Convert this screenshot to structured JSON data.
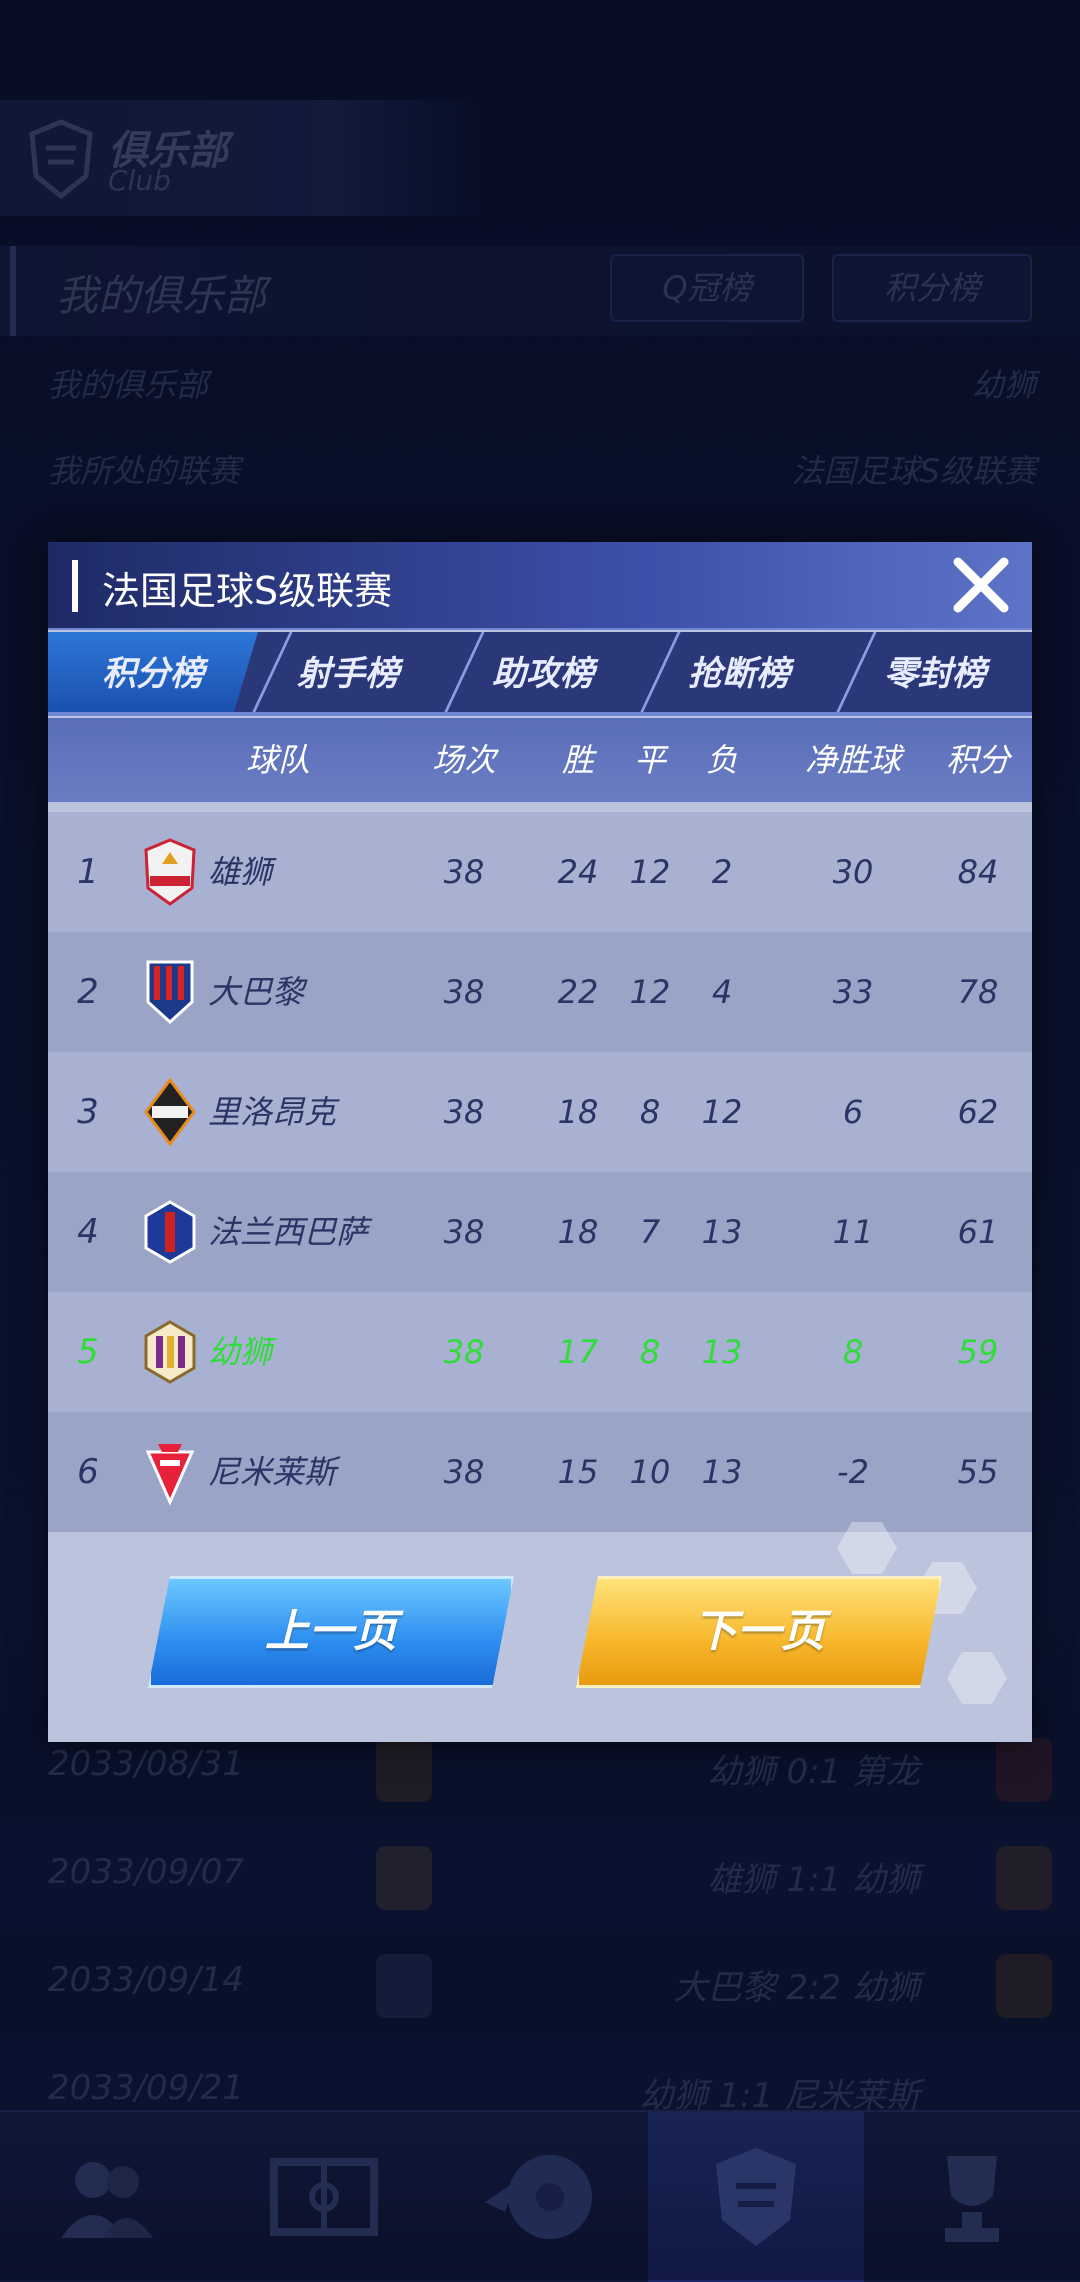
{
  "background": {
    "club_title": "俱乐部",
    "club_subtitle": "Club",
    "section_title": "我的俱乐部",
    "pills": [
      "Q冠榜",
      "积分榜"
    ],
    "info_rows": [
      {
        "label": "我的俱乐部",
        "value": "幼狮"
      },
      {
        "label": "我所处的联赛",
        "value": "法国足球S级联赛"
      }
    ],
    "fixtures": [
      {
        "date": "2033/08/31",
        "match": "幼狮 0:1 第龙"
      },
      {
        "date": "2033/09/07",
        "match": "雄狮 1:1 幼狮"
      },
      {
        "date": "2033/09/14",
        "match": "大巴黎 2:2 幼狮"
      },
      {
        "date": "2033/09/21",
        "match": "幼狮 1:1 尼米莱斯"
      }
    ]
  },
  "modal": {
    "title": "法国足球S级联赛",
    "tabs": [
      "积分榜",
      "射手榜",
      "助攻榜",
      "抢断榜",
      "零封榜"
    ],
    "active_tab": "积分榜",
    "headers": {
      "team": "球队",
      "played": "场次",
      "win": "胜",
      "draw": "平",
      "loss": "负",
      "goal_diff": "净胜球",
      "points": "积分"
    },
    "rows": [
      {
        "rank": "1",
        "team": "雄狮",
        "played": "38",
        "win": "24",
        "draw": "12",
        "loss": "2",
        "goal_diff": "30",
        "points": "84"
      },
      {
        "rank": "2",
        "team": "大巴黎",
        "played": "38",
        "win": "22",
        "draw": "12",
        "loss": "4",
        "goal_diff": "33",
        "points": "78"
      },
      {
        "rank": "3",
        "team": "里洛昂克",
        "played": "38",
        "win": "18",
        "draw": "8",
        "loss": "12",
        "goal_diff": "6",
        "points": "62"
      },
      {
        "rank": "4",
        "team": "法兰西巴萨",
        "played": "38",
        "win": "18",
        "draw": "7",
        "loss": "13",
        "goal_diff": "11",
        "points": "61"
      },
      {
        "rank": "5",
        "team": "幼狮",
        "played": "38",
        "win": "17",
        "draw": "8",
        "loss": "13",
        "goal_diff": "8",
        "points": "59"
      },
      {
        "rank": "6",
        "team": "尼米莱斯",
        "played": "38",
        "win": "15",
        "draw": "10",
        "loss": "13",
        "goal_diff": "-2",
        "points": "55"
      }
    ],
    "prev_label": "上一页",
    "next_label": "下一页"
  },
  "colors": {
    "highlight": "#2fdc3a",
    "accent": "#2d76d6"
  }
}
